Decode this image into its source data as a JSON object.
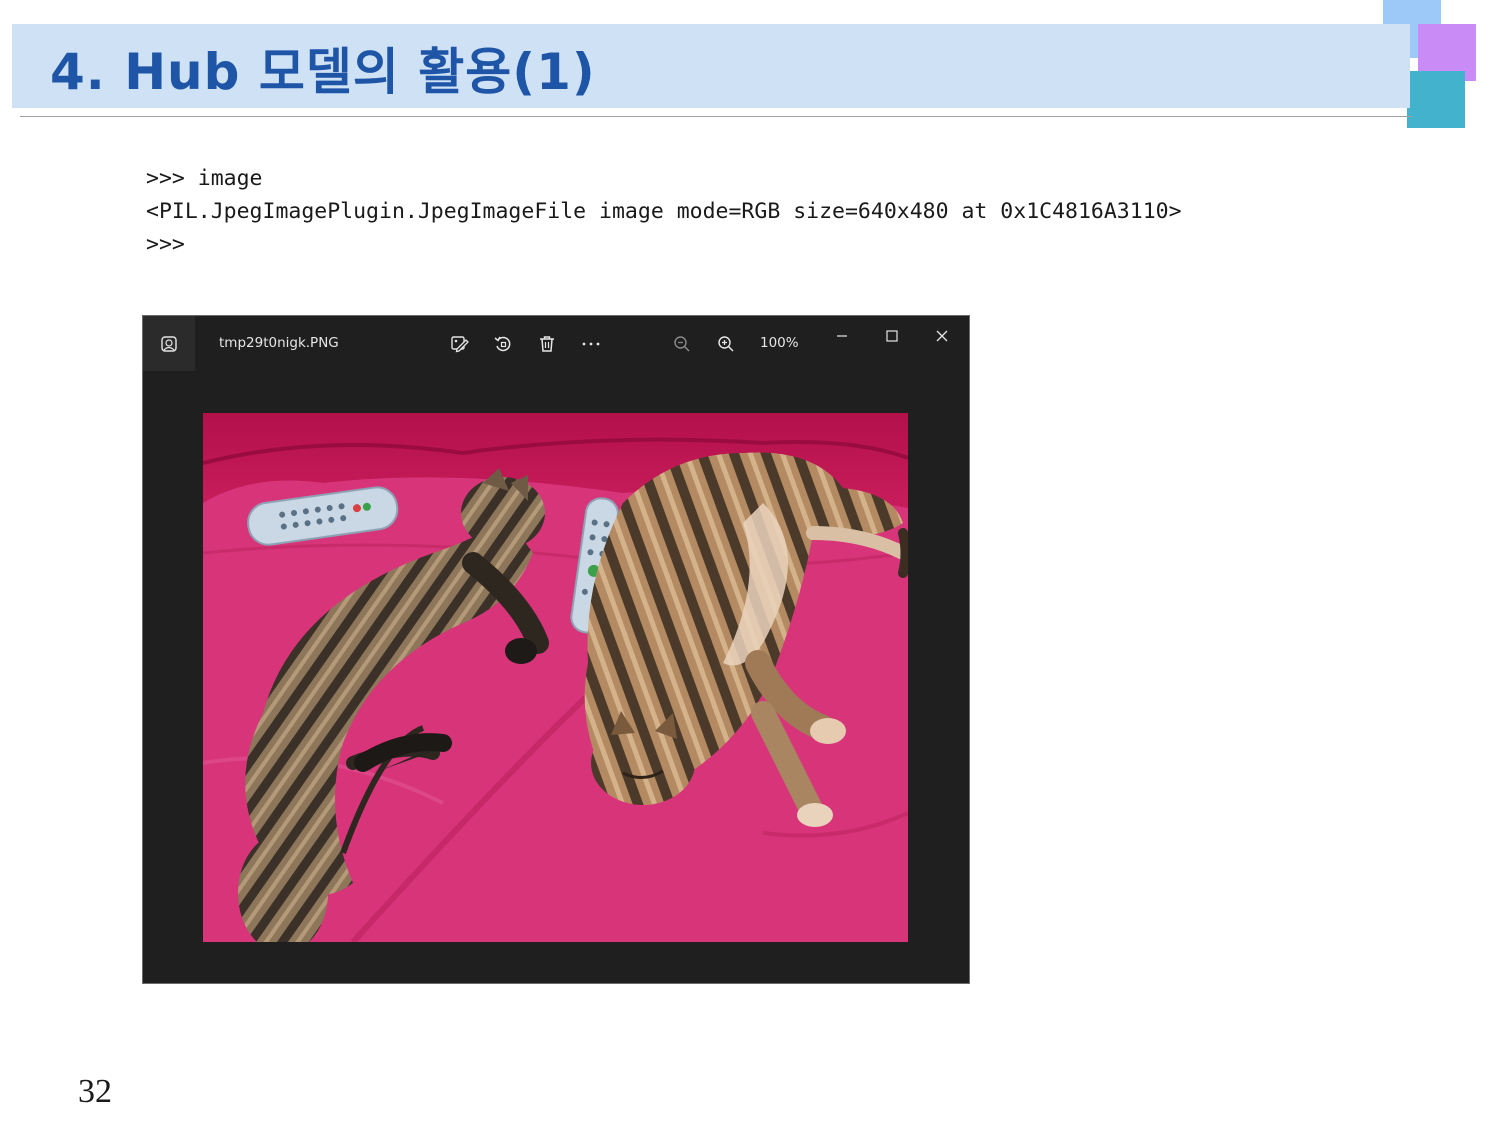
{
  "slide": {
    "title": "4. Hub 모델의 활용(1)",
    "page_number": "32"
  },
  "console": {
    "lines": [
      ">>> image",
      "<PIL.JpegImagePlugin.JpegImageFile image mode=RGB size=640x480 at 0x1C4816A3110>",
      ">>>"
    ]
  },
  "viewer": {
    "file_name": "tmp29t0nigk.PNG",
    "zoom_level": "100%",
    "icons": {
      "app": "photos-app-icon",
      "edit": "edit-image-icon",
      "rotate": "rotate-icon",
      "delete": "trash-icon",
      "more": "more-icon",
      "zoom_out": "zoom-out-icon",
      "zoom_in": "zoom-in-icon",
      "minimize": "minimize-icon",
      "maximize": "maximize-icon",
      "close": "close-icon"
    },
    "photo_subject": "two cats sleeping on a pink blanket with remote controls"
  },
  "colors": {
    "title_text": "#1f55a6",
    "title_band": "#cfe2f5",
    "viewer_bg": "#1f1f1f",
    "blanket": "#d6306f"
  }
}
